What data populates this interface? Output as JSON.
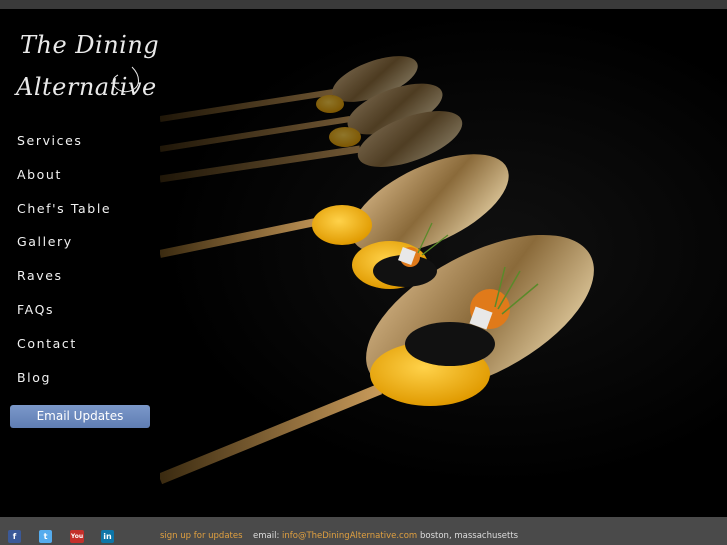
{
  "logo": {
    "line1": "The Dining",
    "line2": "Alternative"
  },
  "nav": {
    "items": [
      "Services",
      "About",
      "Chef's Table",
      "Gallery",
      "Raves",
      "FAQs",
      "Contact",
      "Blog"
    ]
  },
  "email_button": {
    "label": "Email Updates"
  },
  "footer": {
    "social": [
      {
        "icon": "facebook-icon",
        "glyph": "f"
      },
      {
        "icon": "twitter-icon",
        "glyph": "t"
      },
      {
        "icon": "youtube-icon",
        "glyph": "You"
      },
      {
        "icon": "linkedin-icon",
        "glyph": "in"
      }
    ],
    "signup": "sign up for updates",
    "email_label": "email:",
    "email": "info@TheDiningAlternative.com",
    "location": "boston, massachusetts"
  },
  "colors": {
    "accent": "#e0a040",
    "button": "#6d8ac0",
    "footer_bg": "#4a4a4a",
    "yolk": "#f2b705"
  }
}
